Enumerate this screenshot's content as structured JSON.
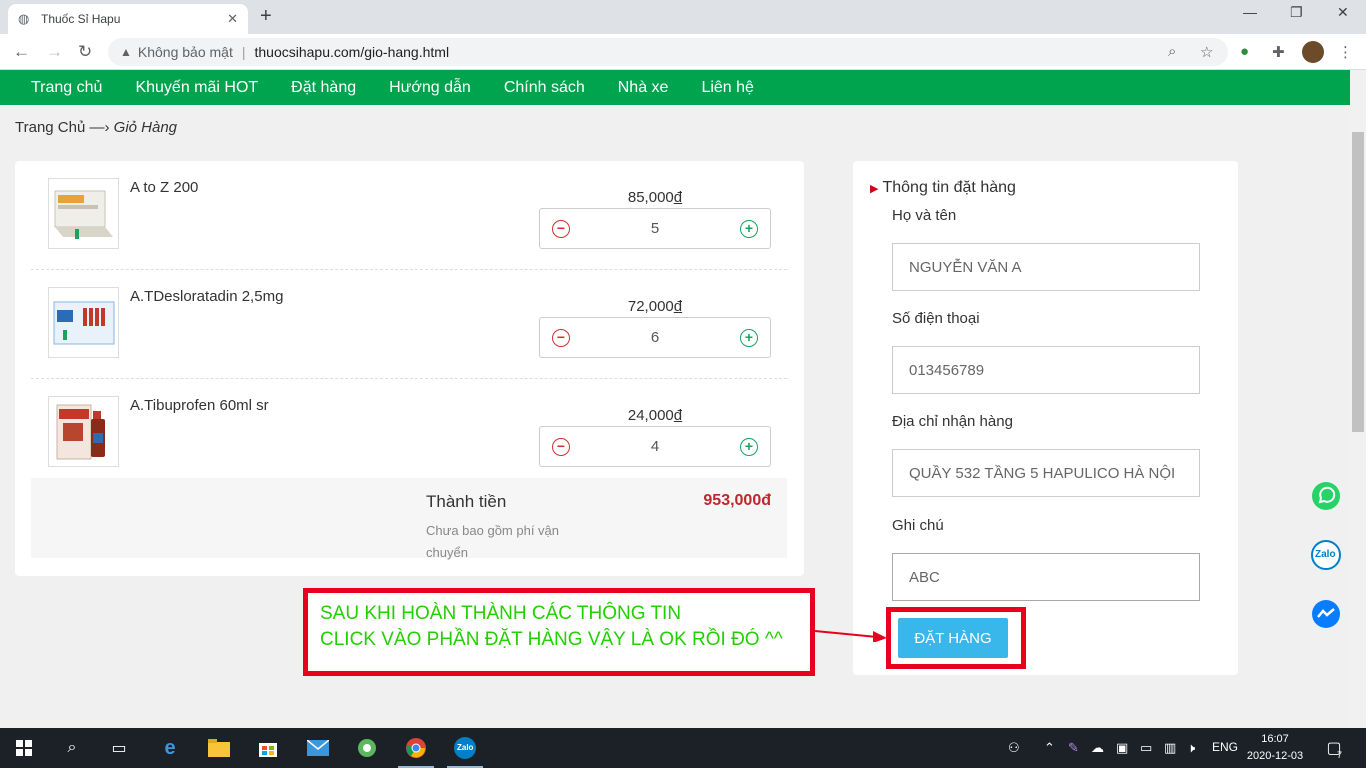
{
  "browser": {
    "tab_title": "Thuốc Sỉ Hapu",
    "security_label": "Không bảo mật",
    "url": "thuocsihapu.com/gio-hang.html"
  },
  "nav": {
    "items": [
      "Trang chủ",
      "Khuyến mãi HOT",
      "Đặt hàng",
      "Hướng dẫn",
      "Chính sách",
      "Nhà xe",
      "Liên hệ"
    ]
  },
  "breadcrumb": {
    "home": "Trang Chủ",
    "separator": "—›",
    "current": "Giỏ Hàng"
  },
  "cart": {
    "items": [
      {
        "name": "A to Z 200",
        "price": "85,000",
        "currency": "đ",
        "qty": "5"
      },
      {
        "name": "A.TDesloratadin 2,5mg",
        "price": "72,000",
        "currency": "đ",
        "qty": "6"
      },
      {
        "name": "A.Tibuprofen 60ml sr",
        "price": "24,000",
        "currency": "đ",
        "qty": "4"
      }
    ],
    "total_label": "Thành tiền",
    "total_note": "Chưa bao gồm phí vận chuyển",
    "total_value": "953,000đ"
  },
  "order_form": {
    "title": "Thông tin đặt hàng",
    "fields": [
      {
        "label": "Họ và tên",
        "value": "NGUYỄN VĂN A"
      },
      {
        "label": "Số điện thoại",
        "value": "013456789"
      },
      {
        "label": "Địa chỉ nhận hàng",
        "value": "QUẦY 532 TẦNG 5 HAPULICO HÀ NỘI"
      },
      {
        "label": "Ghi chú",
        "value": "ABC"
      }
    ],
    "submit_label": "ĐẶT HÀNG"
  },
  "annotation": {
    "line1": "SAU KHI HOÀN THÀNH CÁC THÔNG TIN",
    "line2": "CLICK VÀO PHẦN ĐẶT HÀNG VẬY LÀ OK RỒI ĐÓ ^^"
  },
  "floating": {
    "zalo_label": "Zalo"
  },
  "taskbar": {
    "lang": "ENG",
    "time": "16:07",
    "date": "2020-12-03",
    "notif_count": "7",
    "zalo_label": "Zalo"
  },
  "colors": {
    "nav_green": "#00a44f",
    "total_red": "#c0272d",
    "order_button": "#3ab7ea",
    "highlight_red": "#e8001c",
    "annotation_green": "#22d000"
  }
}
